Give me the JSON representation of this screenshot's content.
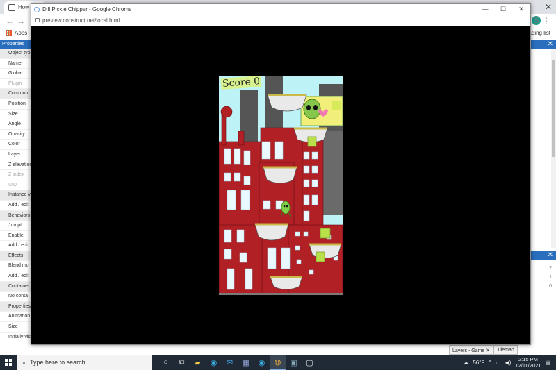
{
  "background_browser": {
    "tab_title": "How d",
    "bookmarks": {
      "apps_label": "Apps",
      "reading_list": "ading list"
    },
    "avatar_letter": "S"
  },
  "properties_panel": {
    "header": "Properties",
    "rows": [
      {
        "label": "Object typ",
        "section": true
      },
      {
        "label": "Name"
      },
      {
        "label": "Global"
      },
      {
        "label": "Plugin",
        "dim": true
      },
      {
        "label": "Common",
        "section": true
      },
      {
        "label": "Position"
      },
      {
        "label": "Size"
      },
      {
        "label": "Angle"
      },
      {
        "label": "Opacity"
      },
      {
        "label": "Color"
      },
      {
        "label": "Layer"
      },
      {
        "label": "Z elevation"
      },
      {
        "label": "Z index",
        "dim": true
      },
      {
        "label": "UID",
        "dim": true
      },
      {
        "label": "Instance v",
        "section": true
      },
      {
        "label": "Add / edit"
      },
      {
        "label": "Behaviors",
        "section": true
      },
      {
        "label": "Jumpt"
      },
      {
        "label": "Enable"
      },
      {
        "label": "Add / edit"
      },
      {
        "label": "Effects",
        "section": true
      },
      {
        "label": "Blend mo"
      },
      {
        "label": "Add / edit"
      },
      {
        "label": "Container",
        "section": true
      },
      {
        "label": "No conta"
      },
      {
        "label": "Properties",
        "section": true
      },
      {
        "label": "Animation"
      },
      {
        "label": "Size"
      },
      {
        "label": "Initially visible"
      }
    ]
  },
  "right_panel": {
    "close_glyph": "✕",
    "layer_numbers": [
      "2",
      "1",
      "0"
    ]
  },
  "bottom_tabs": [
    "Layers - Game ✕",
    "Tilemap"
  ],
  "popup": {
    "title": "Dill Pickle Chipper - Google Chrome",
    "url": "preview.construct.net/local.html",
    "controls": {
      "minimize": "—",
      "maximize": "☐",
      "close": "✕"
    }
  },
  "game": {
    "score_label": "Score",
    "score_value": "0"
  },
  "taskbar": {
    "search_placeholder": "Type here to search",
    "weather": "56°F",
    "time": "2:15 PM",
    "date": "12/11/2021"
  }
}
